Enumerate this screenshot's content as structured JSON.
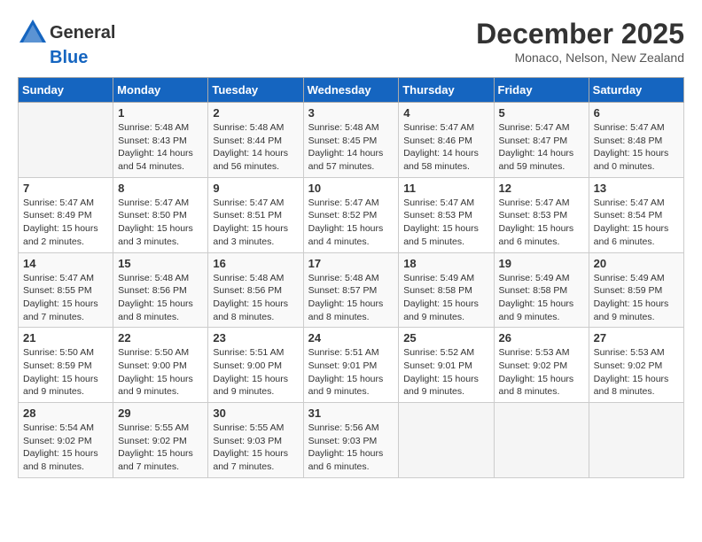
{
  "header": {
    "logo_general": "General",
    "logo_blue": "Blue",
    "month": "December 2025",
    "location": "Monaco, Nelson, New Zealand"
  },
  "days_of_week": [
    "Sunday",
    "Monday",
    "Tuesday",
    "Wednesday",
    "Thursday",
    "Friday",
    "Saturday"
  ],
  "weeks": [
    [
      {
        "day": "",
        "info": ""
      },
      {
        "day": "1",
        "info": "Sunrise: 5:48 AM\nSunset: 8:43 PM\nDaylight: 14 hours\nand 54 minutes."
      },
      {
        "day": "2",
        "info": "Sunrise: 5:48 AM\nSunset: 8:44 PM\nDaylight: 14 hours\nand 56 minutes."
      },
      {
        "day": "3",
        "info": "Sunrise: 5:48 AM\nSunset: 8:45 PM\nDaylight: 14 hours\nand 57 minutes."
      },
      {
        "day": "4",
        "info": "Sunrise: 5:47 AM\nSunset: 8:46 PM\nDaylight: 14 hours\nand 58 minutes."
      },
      {
        "day": "5",
        "info": "Sunrise: 5:47 AM\nSunset: 8:47 PM\nDaylight: 14 hours\nand 59 minutes."
      },
      {
        "day": "6",
        "info": "Sunrise: 5:47 AM\nSunset: 8:48 PM\nDaylight: 15 hours\nand 0 minutes."
      }
    ],
    [
      {
        "day": "7",
        "info": "Sunrise: 5:47 AM\nSunset: 8:49 PM\nDaylight: 15 hours\nand 2 minutes."
      },
      {
        "day": "8",
        "info": "Sunrise: 5:47 AM\nSunset: 8:50 PM\nDaylight: 15 hours\nand 3 minutes."
      },
      {
        "day": "9",
        "info": "Sunrise: 5:47 AM\nSunset: 8:51 PM\nDaylight: 15 hours\nand 3 minutes."
      },
      {
        "day": "10",
        "info": "Sunrise: 5:47 AM\nSunset: 8:52 PM\nDaylight: 15 hours\nand 4 minutes."
      },
      {
        "day": "11",
        "info": "Sunrise: 5:47 AM\nSunset: 8:53 PM\nDaylight: 15 hours\nand 5 minutes."
      },
      {
        "day": "12",
        "info": "Sunrise: 5:47 AM\nSunset: 8:53 PM\nDaylight: 15 hours\nand 6 minutes."
      },
      {
        "day": "13",
        "info": "Sunrise: 5:47 AM\nSunset: 8:54 PM\nDaylight: 15 hours\nand 6 minutes."
      }
    ],
    [
      {
        "day": "14",
        "info": "Sunrise: 5:47 AM\nSunset: 8:55 PM\nDaylight: 15 hours\nand 7 minutes."
      },
      {
        "day": "15",
        "info": "Sunrise: 5:48 AM\nSunset: 8:56 PM\nDaylight: 15 hours\nand 8 minutes."
      },
      {
        "day": "16",
        "info": "Sunrise: 5:48 AM\nSunset: 8:56 PM\nDaylight: 15 hours\nand 8 minutes."
      },
      {
        "day": "17",
        "info": "Sunrise: 5:48 AM\nSunset: 8:57 PM\nDaylight: 15 hours\nand 8 minutes."
      },
      {
        "day": "18",
        "info": "Sunrise: 5:49 AM\nSunset: 8:58 PM\nDaylight: 15 hours\nand 9 minutes."
      },
      {
        "day": "19",
        "info": "Sunrise: 5:49 AM\nSunset: 8:58 PM\nDaylight: 15 hours\nand 9 minutes."
      },
      {
        "day": "20",
        "info": "Sunrise: 5:49 AM\nSunset: 8:59 PM\nDaylight: 15 hours\nand 9 minutes."
      }
    ],
    [
      {
        "day": "21",
        "info": "Sunrise: 5:50 AM\nSunset: 8:59 PM\nDaylight: 15 hours\nand 9 minutes."
      },
      {
        "day": "22",
        "info": "Sunrise: 5:50 AM\nSunset: 9:00 PM\nDaylight: 15 hours\nand 9 minutes."
      },
      {
        "day": "23",
        "info": "Sunrise: 5:51 AM\nSunset: 9:00 PM\nDaylight: 15 hours\nand 9 minutes."
      },
      {
        "day": "24",
        "info": "Sunrise: 5:51 AM\nSunset: 9:01 PM\nDaylight: 15 hours\nand 9 minutes."
      },
      {
        "day": "25",
        "info": "Sunrise: 5:52 AM\nSunset: 9:01 PM\nDaylight: 15 hours\nand 9 minutes."
      },
      {
        "day": "26",
        "info": "Sunrise: 5:53 AM\nSunset: 9:02 PM\nDaylight: 15 hours\nand 8 minutes."
      },
      {
        "day": "27",
        "info": "Sunrise: 5:53 AM\nSunset: 9:02 PM\nDaylight: 15 hours\nand 8 minutes."
      }
    ],
    [
      {
        "day": "28",
        "info": "Sunrise: 5:54 AM\nSunset: 9:02 PM\nDaylight: 15 hours\nand 8 minutes."
      },
      {
        "day": "29",
        "info": "Sunrise: 5:55 AM\nSunset: 9:02 PM\nDaylight: 15 hours\nand 7 minutes."
      },
      {
        "day": "30",
        "info": "Sunrise: 5:55 AM\nSunset: 9:03 PM\nDaylight: 15 hours\nand 7 minutes."
      },
      {
        "day": "31",
        "info": "Sunrise: 5:56 AM\nSunset: 9:03 PM\nDaylight: 15 hours\nand 6 minutes."
      },
      {
        "day": "",
        "info": ""
      },
      {
        "day": "",
        "info": ""
      },
      {
        "day": "",
        "info": ""
      }
    ]
  ]
}
